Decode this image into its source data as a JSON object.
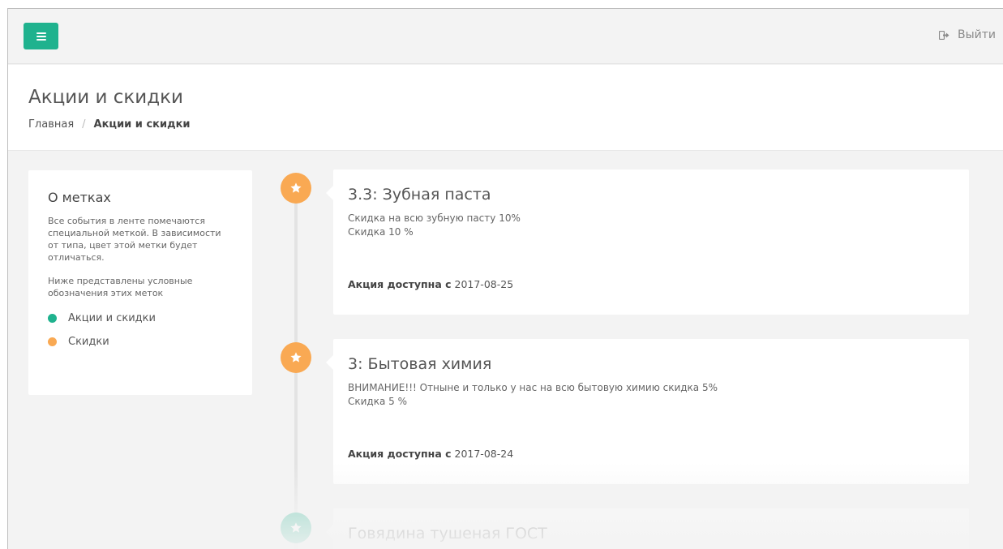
{
  "topbar": {
    "logout_label": "Выйти"
  },
  "header": {
    "title": "Акции и скидки",
    "breadcrumb": [
      {
        "label": "Главная"
      },
      {
        "label": "Акции и скидки"
      }
    ],
    "breadcrumb_separator": "/"
  },
  "sidebar": {
    "title": "О метках",
    "paragraph1": "Все события в ленте помечаются специальной меткой. В зависимости от типа, цвет этой метки будет отличаться.",
    "paragraph2": "Ниже представлены условные обозначения этих меток",
    "legend": [
      {
        "label": "Акции и скидки",
        "color": "#1fb28e"
      },
      {
        "label": "Скидки",
        "color": "#f9a953"
      }
    ]
  },
  "timeline": {
    "items": [
      {
        "title": "3.3: Зубная паста",
        "line1": "Скидка на всю зубную пасту 10%",
        "line2": "Скидка 10 %",
        "avail_label": "Акция доступна с",
        "avail_date": "2017-08-25",
        "marker_color": "#f9a953",
        "marker_icon": "star-icon"
      },
      {
        "title": "3: Бытовая химия",
        "line1": "ВНИМАНИЕ!!! Отныне и только у нас на всю бытовую химию скидка 5%",
        "line2": "Скидка 5 %",
        "avail_label": "Акция доступна с",
        "avail_date": "2017-08-24",
        "marker_color": "#f9a953",
        "marker_icon": "star-icon"
      },
      {
        "title": "Говядина тушеная ГОСТ",
        "marker_color": "#1fb28e",
        "marker_icon": "star-icon"
      }
    ]
  },
  "colors": {
    "accent": "#1fb28e",
    "discount": "#f9a953"
  }
}
